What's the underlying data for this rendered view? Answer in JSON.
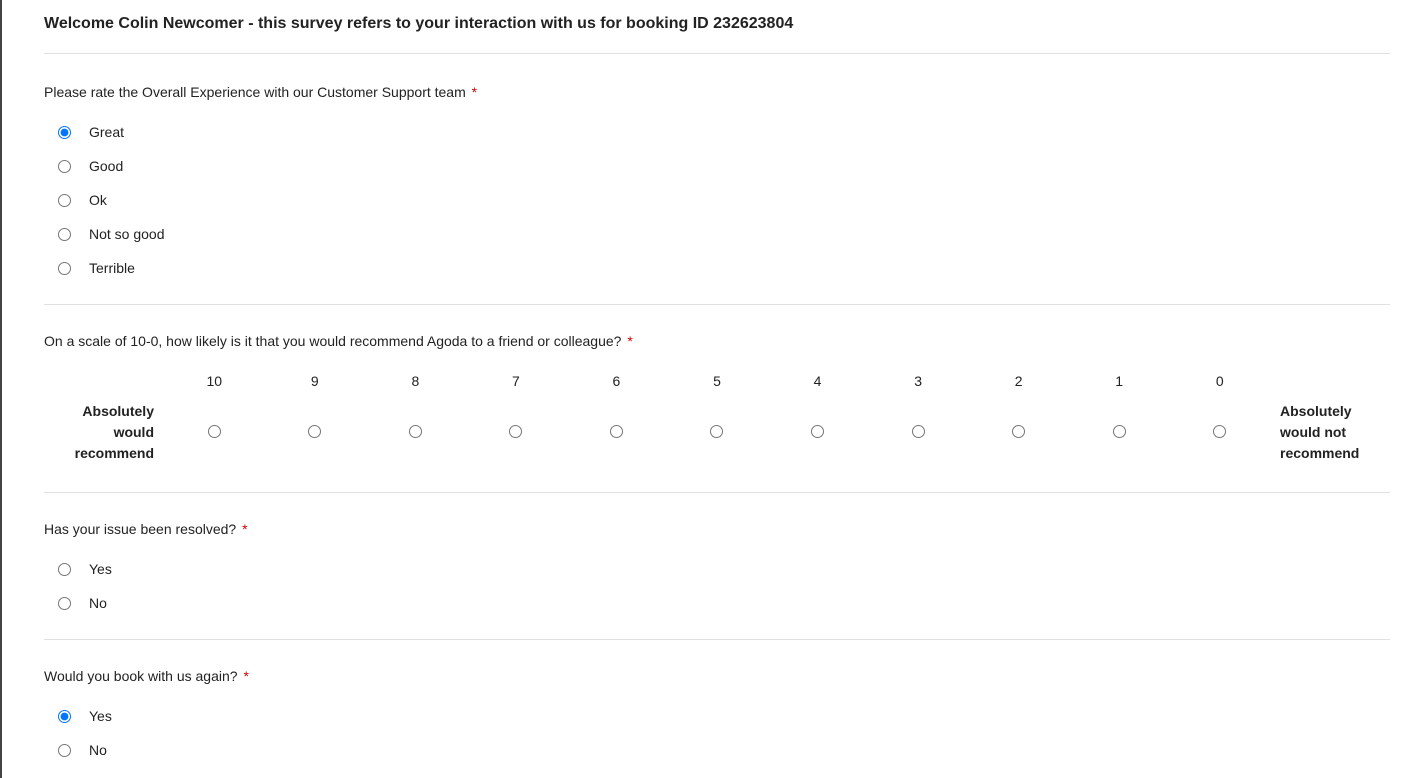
{
  "header": {
    "title": "Welcome Colin Newcomer - this survey refers to your interaction with us for booking ID 232623804"
  },
  "required_marker": "*",
  "q1": {
    "text": "Please rate the Overall Experience with our Customer Support team",
    "options": [
      "Great",
      "Good",
      "Ok",
      "Not so good",
      "Terrible"
    ],
    "selected": "Great"
  },
  "q2": {
    "text": "On a scale of 10-0, how likely is it that you would recommend Agoda to a friend or colleague?",
    "scale_labels": [
      "10",
      "9",
      "8",
      "7",
      "6",
      "5",
      "4",
      "3",
      "2",
      "1",
      "0"
    ],
    "anchor_left": "Absolutely would recommend",
    "anchor_right": "Absolutely would not recommend",
    "selected": null
  },
  "q3": {
    "text": "Has your issue been resolved?",
    "options": [
      "Yes",
      "No"
    ],
    "selected": null
  },
  "q4": {
    "text": "Would you book with us again?",
    "options": [
      "Yes",
      "No"
    ],
    "selected": "Yes"
  }
}
